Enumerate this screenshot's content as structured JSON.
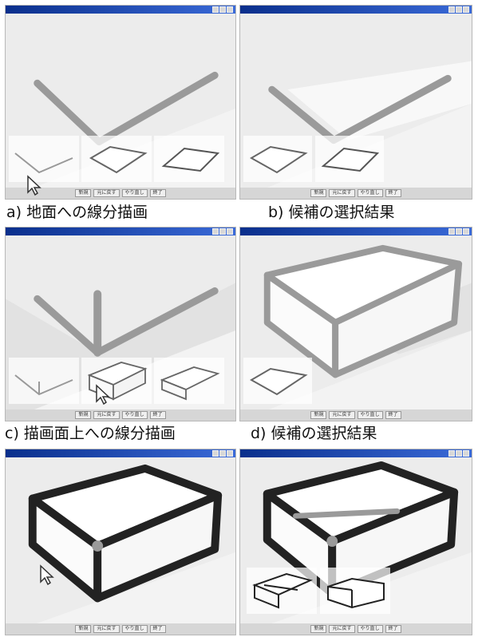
{
  "captions": {
    "a": "a) 地面への線分描画",
    "b": "b) 候補の選択結果",
    "c": "c) 描画面上への線分描画",
    "d": "d) 候補の選択結果"
  },
  "window": {
    "button_labels": [
      "新規",
      "元に戻す",
      "やり直し",
      "終了"
    ]
  },
  "colors": {
    "titlebar": "#0a2f8c",
    "stroke_gray": "#9a9a9a",
    "stroke_black": "#222222",
    "background": "#f3f3f3"
  },
  "icons": [
    "mouse-cursor-icon",
    "minimize-icon",
    "maximize-icon",
    "close-icon"
  ]
}
